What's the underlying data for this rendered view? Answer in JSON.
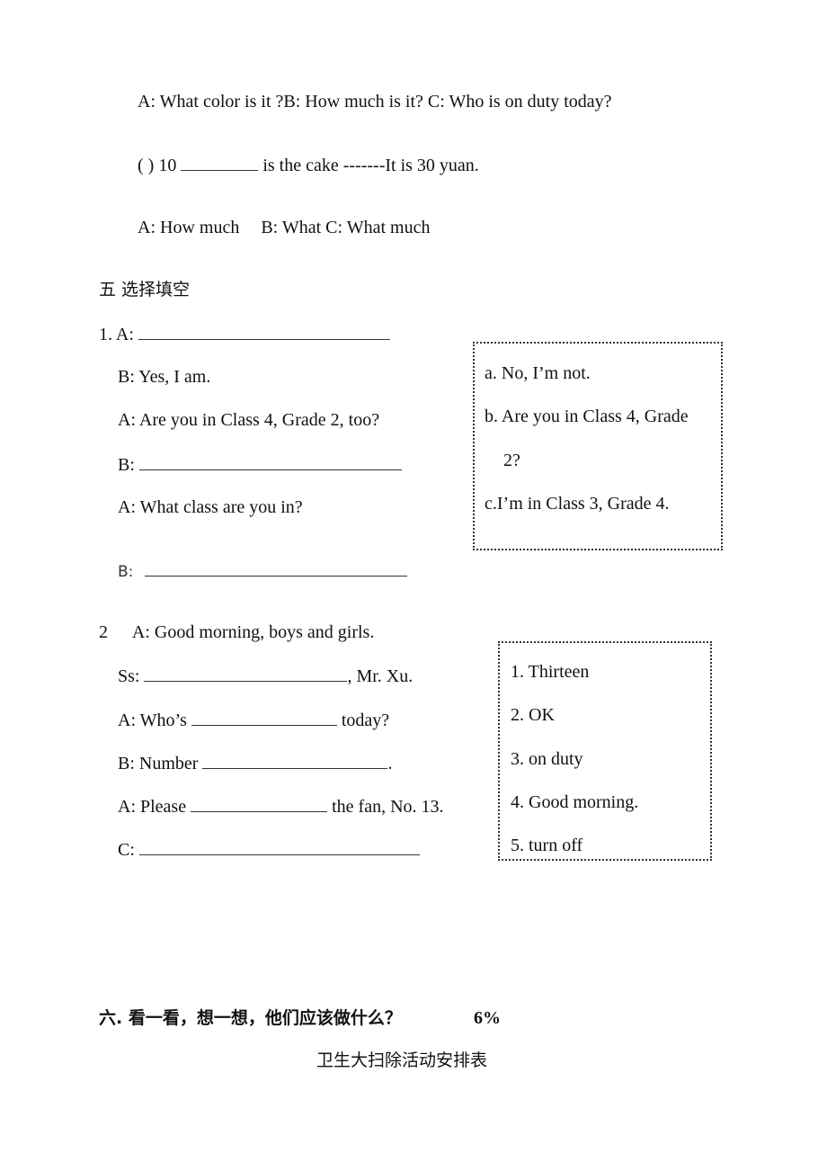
{
  "section4_tail": {
    "options_q9": "A: What color is it ?B: How much is it? C: Who is on duty today?",
    "q10": {
      "prefix": "( ) 10",
      "suffix": "is the cake -------It is 30 yuan."
    },
    "options_q10": {
      "a": "A: How much",
      "bc": "B: What C: What much"
    }
  },
  "section5": {
    "title": "五  选择填空",
    "dialog1": {
      "lines": [
        {
          "speaker": "1. A:",
          "text": ""
        },
        {
          "speaker": "B:",
          "text": "Yes, I am."
        },
        {
          "speaker": "A:",
          "text": "Are you in Class 4, Grade 2, too?"
        },
        {
          "speaker": "B:",
          "text": ""
        },
        {
          "speaker": "A:",
          "text": "What class are you in?"
        },
        {
          "speaker": "B:",
          "text": ""
        }
      ],
      "choices": [
        "a. No, I’m not.",
        "b.  Are you in Class 4, Grade",
        "2?",
        "c.I’m in Class 3, Grade 4."
      ]
    },
    "dialog2": {
      "number": "2",
      "lines": {
        "l1": "A: Good morning, boys and girls.",
        "l2_prefix": "Ss:",
        "l2_suffix": ", Mr. Xu.",
        "l3_prefix": "A: Who’s",
        "l3_suffix": "today?",
        "l4_prefix": "B: Number",
        "l4_suffix": ".",
        "l5_prefix": "A: Please",
        "l5_suffix": "the fan, No. 13.",
        "l6_prefix": "C:"
      },
      "choices": [
        "1.  Thirteen",
        "2.  OK",
        "3.  on duty",
        "4.  Good morning.",
        "5.  turn off"
      ]
    }
  },
  "section6": {
    "title": "六. 看一看，想一想，他们应该做什么？",
    "score": "6%",
    "subtitle": "卫生大扫除活动安排表"
  }
}
